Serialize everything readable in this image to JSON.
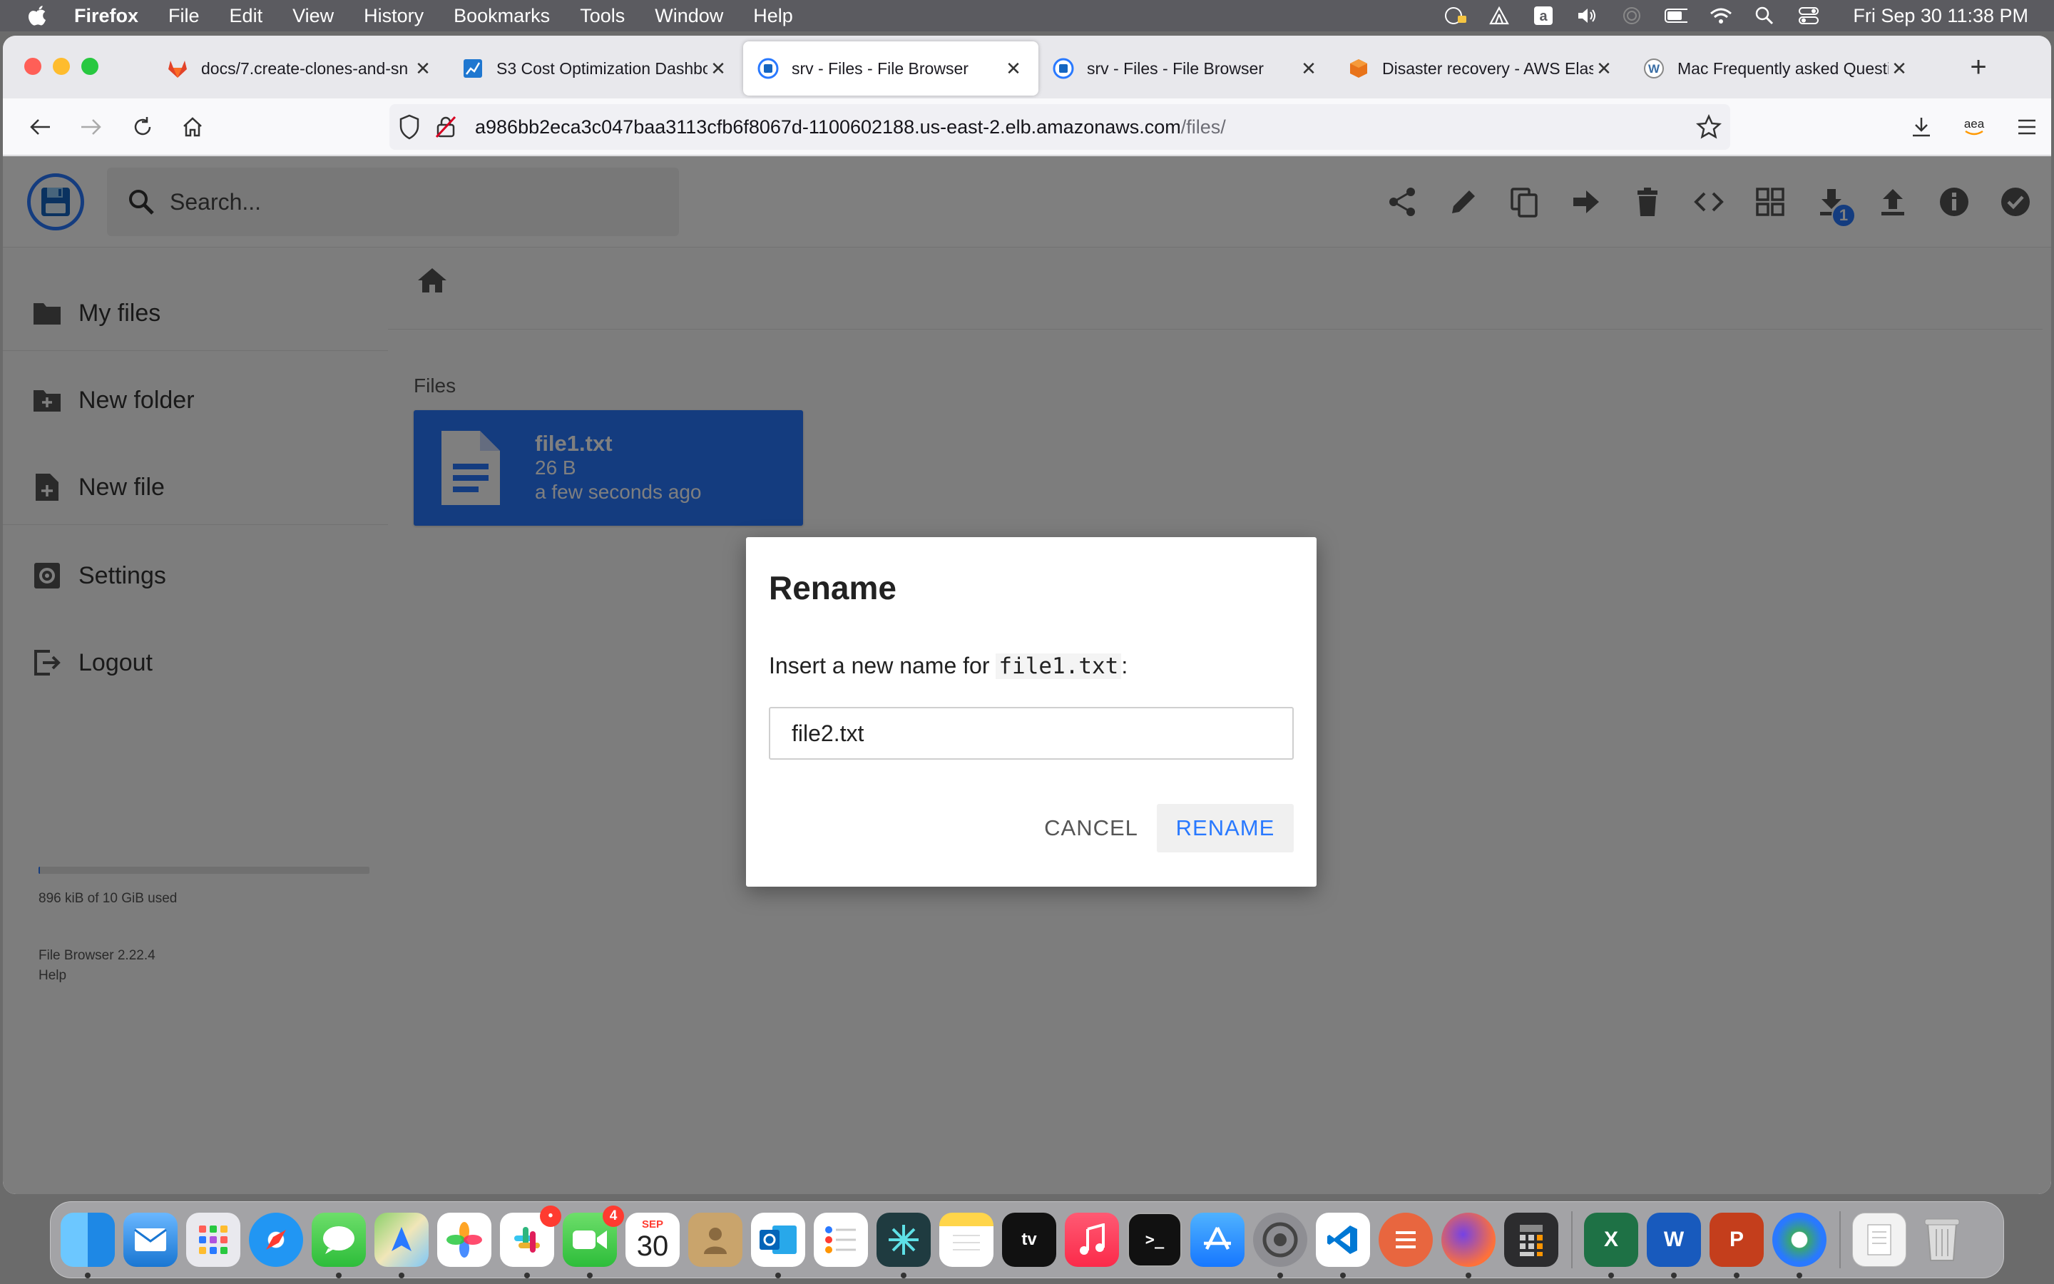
{
  "menubar": {
    "app_name": "Firefox",
    "items": [
      "File",
      "Edit",
      "View",
      "History",
      "Bookmarks",
      "Tools",
      "Window",
      "Help"
    ],
    "clock": "Fri Sep 30  11:38 PM"
  },
  "browser": {
    "tabs": [
      {
        "title": "docs/7.create-clones-and-sn",
        "favicon": "gitlab-icon",
        "active": false
      },
      {
        "title": "S3 Cost Optimization Dashbo",
        "favicon": "dashboard-icon",
        "active": false
      },
      {
        "title": "srv - Files - File Browser",
        "favicon": "filebrowser-icon",
        "active": true
      },
      {
        "title": "srv - Files - File Browser",
        "favicon": "filebrowser-icon",
        "active": false
      },
      {
        "title": "Disaster recovery - AWS Elas",
        "favicon": "aws-icon",
        "active": false
      },
      {
        "title": "Mac Frequently asked Questi",
        "favicon": "wordpress-icon",
        "active": false
      }
    ],
    "url_host": "a986bb2eca3c047baa3113cfb6f8067d-1100602188.us-east-2.elb.amazonaws.com",
    "url_path": "/files/",
    "accent_color": "#2979ff"
  },
  "app": {
    "search_placeholder": "Search...",
    "download_badge": "1",
    "sidebar": {
      "my_files": "My files",
      "new_folder": "New folder",
      "new_file": "New file",
      "settings": "Settings",
      "logout": "Logout",
      "usage": "896 kiB of 10 GiB used",
      "usage_fraction": 0.0001,
      "version": "File Browser 2.22.4",
      "help": "Help"
    },
    "main": {
      "section_title": "Files",
      "file": {
        "name": "file1.txt",
        "size": "26 B",
        "modified": "a few seconds ago"
      }
    }
  },
  "dialog": {
    "title": "Rename",
    "prompt_prefix": "Insert a new name for ",
    "prompt_filename": "file1.txt",
    "prompt_suffix": ":",
    "input_value": "file2.txt",
    "cancel_label": "CANCEL",
    "rename_label": "RENAME"
  },
  "dock": {
    "apps": [
      "Finder",
      "Mail",
      "Launchpad",
      "Safari",
      "Messages",
      "Maps",
      "Photos",
      "Slack",
      "FaceTime",
      "Calendar",
      "Contacts",
      "Outlook",
      "Reminders",
      "Perplexity",
      "Notes",
      "TV",
      "Music",
      "Terminal",
      "App Store",
      "System Preferences",
      "Visual Studio Code",
      "Sublime",
      "Firefox",
      "Calculator",
      "Excel",
      "Word",
      "PowerPoint",
      "Network",
      "Documents",
      "Trash"
    ],
    "calendar_month": "SEP",
    "calendar_day": "30",
    "facetime_badge": "4"
  }
}
